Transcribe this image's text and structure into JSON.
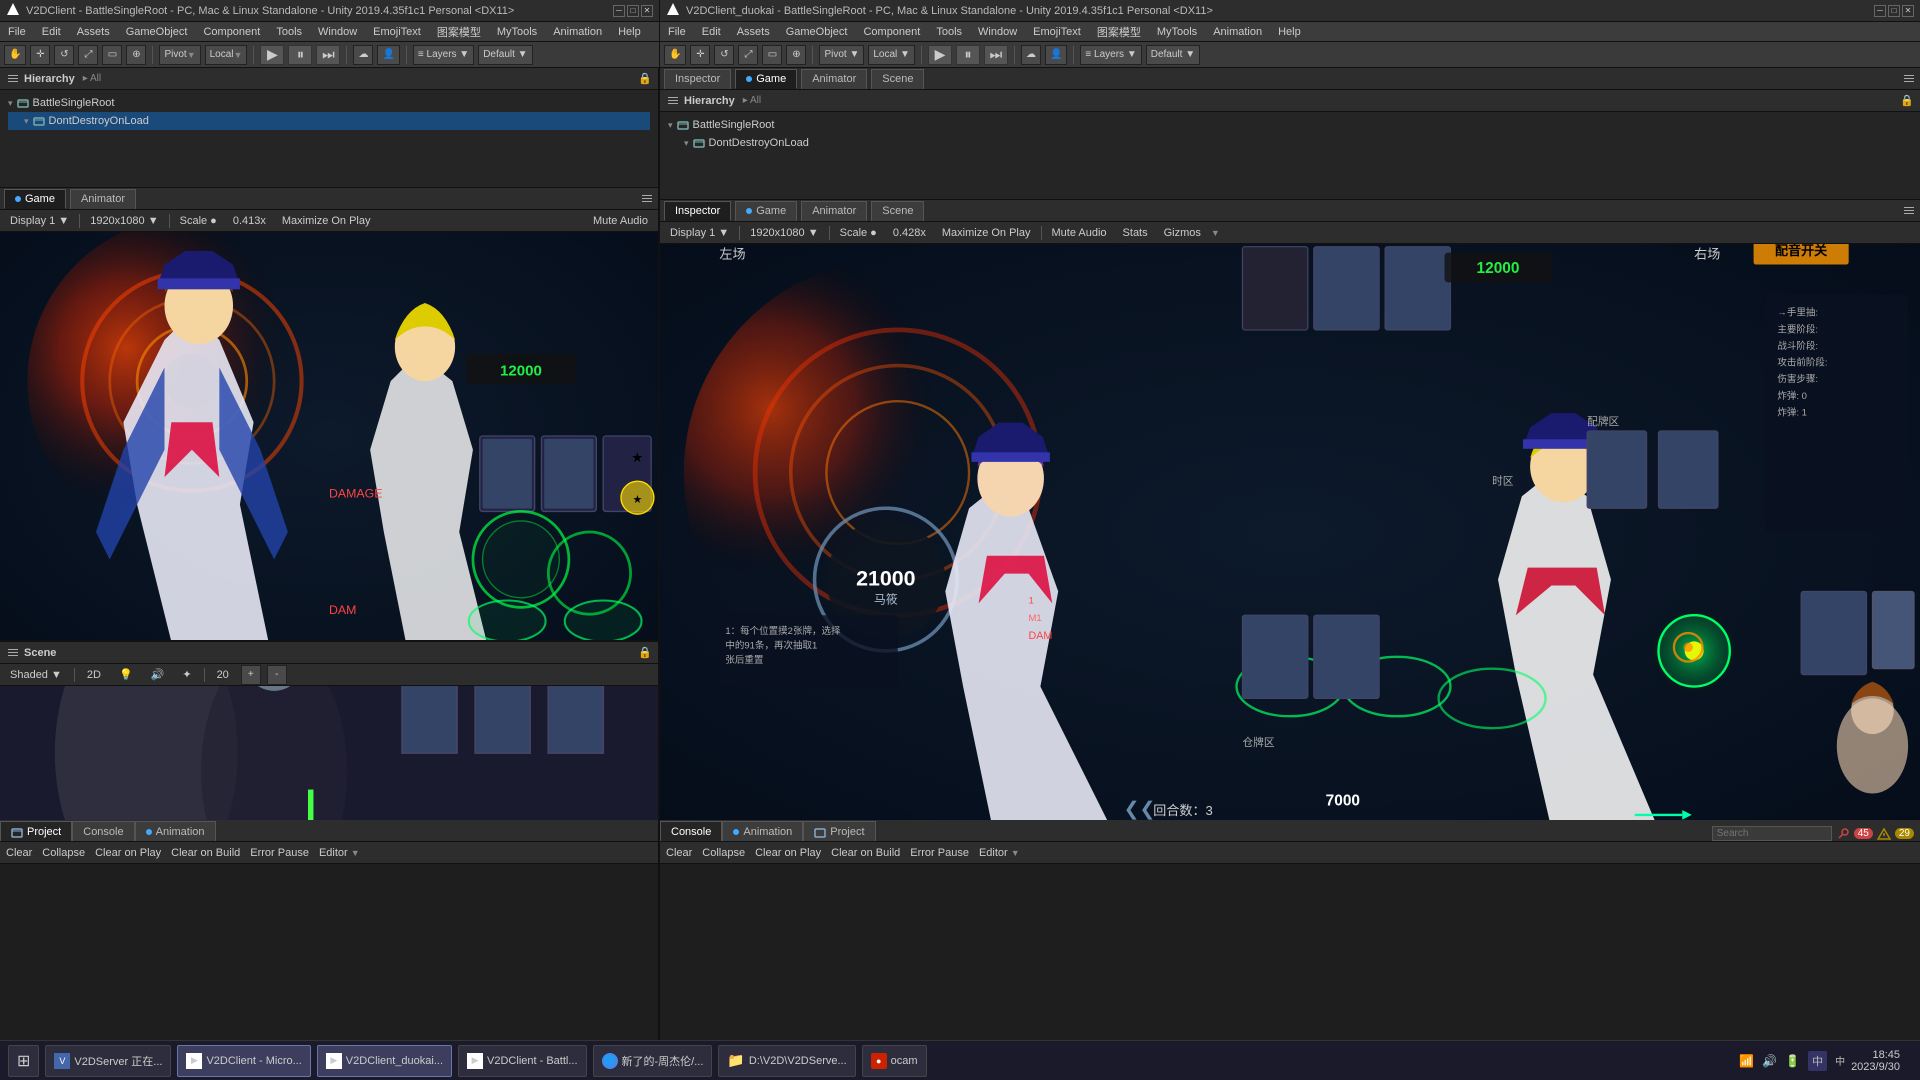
{
  "windows": {
    "left": {
      "title": "V2DClient - BattleSingleRoot - PC, Mac & Linux Standalone - Unity 2019.4.35f1c1 Personal <DX11>",
      "menus": [
        "File",
        "Edit",
        "Assets",
        "GameObject",
        "Component",
        "Tools",
        "Window",
        "EmojiText",
        "图案模型",
        "MyTools",
        "Animation",
        "Help"
      ]
    },
    "right": {
      "title": "V2DClient_duokai - BattleSingleRoot - PC, Mac & Linux Standalone - Unity 2019.4.35f1c1 Personal <DX11>",
      "menus": [
        "File",
        "Edit",
        "Assets",
        "GameObject",
        "Component",
        "Tools",
        "Window",
        "EmojiText",
        "图案模型",
        "MyTools",
        "Animation",
        "Help"
      ]
    }
  },
  "toolbar": {
    "pivot_label": "Pivot",
    "local_label": "Local",
    "scale_label": "Scale",
    "scale_value_left": "0.413x",
    "scale_value_right": "0.428x",
    "display_left": "Display 1",
    "display_right": "Display 1",
    "resolution_left": "1920x1080",
    "resolution_right": "1920x1080",
    "maximize_label": "Maximize On Play",
    "mute_label": "Mute Audio",
    "stats_label": "Stats",
    "gizmos_label": "Gizmos"
  },
  "hierarchy": {
    "title": "Hierarchy",
    "left": {
      "items": [
        {
          "label": "BattleSingleRoot",
          "depth": 0,
          "icon": "scene"
        },
        {
          "label": "DontDestroyOnLoad",
          "depth": 1,
          "icon": "scene"
        }
      ]
    },
    "right": {
      "items": [
        {
          "label": "BattleSingleRoot",
          "depth": 0,
          "icon": "scene"
        },
        {
          "label": "DontDestroyOnLoad",
          "depth": 1,
          "icon": "scene"
        }
      ]
    }
  },
  "inspector": {
    "title": "Inspector"
  },
  "panels": {
    "left_tabs": [
      {
        "label": "Game",
        "active": true,
        "dot": true
      },
      {
        "label": "Animator",
        "active": false
      }
    ],
    "right_tabs": [
      {
        "label": "Inspector",
        "active": false
      },
      {
        "label": "Game",
        "active": true,
        "dot": true
      },
      {
        "label": "Animator",
        "active": false
      },
      {
        "label": "Scene",
        "active": false
      }
    ],
    "scene": {
      "title": "Scene",
      "shaded": "Shaded",
      "zoom": "20"
    }
  },
  "bottom_left": {
    "tabs": [
      {
        "label": "Project",
        "icon": "folder",
        "active": true
      },
      {
        "label": "Console",
        "icon": "console"
      },
      {
        "label": "Animation",
        "icon": "anim",
        "dot": true
      }
    ],
    "toolbar": {
      "clear": "Clear",
      "collapse": "Collapse",
      "clear_on_play": "Clear on Play",
      "clear_on_build": "Clear on Build",
      "error_pause": "Error Pause",
      "editor": "Editor"
    }
  },
  "bottom_right": {
    "tabs": [
      {
        "label": "Console",
        "icon": "console",
        "active": true
      },
      {
        "label": "Animation",
        "icon": "anim",
        "dot": true
      },
      {
        "label": "Project",
        "icon": "folder"
      }
    ],
    "toolbar": {
      "clear": "Clear",
      "collapse": "Collapse",
      "clear_on_play": "Clear on Play",
      "clear_on_build": "Clear on Build",
      "error_pause": "Error Pause",
      "editor": "Editor"
    },
    "badges": {
      "errors": "45",
      "warnings": "29"
    },
    "search_placeholder": "Search"
  },
  "taskbar": {
    "start_icon": "⊞",
    "apps": [
      {
        "label": "V2DServer 正在...",
        "icon": "🖥",
        "active": false
      },
      {
        "label": "V2DClient - Micro...",
        "icon": "▶",
        "active": false
      },
      {
        "label": "V2DClient_duokai...",
        "icon": "▶",
        "active": true
      },
      {
        "label": "V2DClient - Battl...",
        "icon": "▶",
        "active": false
      },
      {
        "label": "新了的-周杰伦/...",
        "icon": "🌐",
        "active": false
      },
      {
        "label": "D:\\V2D\\V2DServe...",
        "icon": "📁",
        "active": false
      },
      {
        "label": "ocam",
        "icon": "🎥",
        "active": false
      }
    ],
    "sys_tray": {
      "time": "18:45",
      "date": "2023/9/30",
      "lang": "中",
      "indicators": [
        "🔋",
        "🔊",
        "📶"
      ]
    }
  }
}
